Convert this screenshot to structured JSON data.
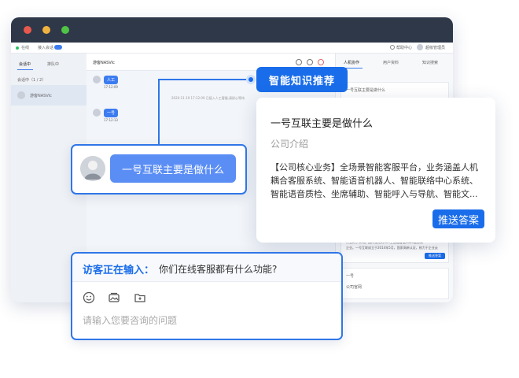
{
  "topbar": {
    "status_label": "在线",
    "access_label": "接入会话",
    "help_label": "帮助中心",
    "user_label": "超级管理员"
  },
  "left_panel": {
    "tabs": [
      "会话中",
      "排队中"
    ],
    "session_count": "会话中（1 / 2）",
    "session_item": "游客NASVlc"
  },
  "chat": {
    "visitor_name": "游客NASVlc",
    "msg1": "人工",
    "msg1_time": "17:12:09",
    "system_note": "2020-11-19 17:12:09 已接入人工客服,请耐心等待",
    "msg2": "一号",
    "msg2_time": "17:12:13"
  },
  "right_panel": {
    "tabs": [
      "人机协作",
      "用户资料",
      "知识搜索"
    ],
    "query_preview": "一号互联主要是做什么",
    "bg_text_1": "行业的子公司。国内领先的AI人工智能客服SaaS服务商",
    "bg_text_2": "企业。一号互联成立于2014年5月，国家高新认证，致力于企业云",
    "bg_btn": "推送答案",
    "bg_item_1": "一号",
    "bg_item_2": "公司官网"
  },
  "knowledge": {
    "tag": "智能知识推荐",
    "question": "一号互联主要是做什么",
    "category": "公司介绍",
    "answer_line1": "【公司核心业务】全场景智能客服平台，业务涵盖人机",
    "answer_line2": "耦合客服系统、智能语音机器人、智能联络中心系统、",
    "answer_line3": "智能语音质检、坐席辅助、智能呼入与导航、智能文...",
    "push_button": "推送答案"
  },
  "question_card": {
    "text": "一号互联主要是做什么"
  },
  "input_card": {
    "typing_label": "访客正在输入：",
    "typing_text": "你们在线客服都有什么功能?",
    "placeholder": "请输入您要咨询的问题"
  },
  "icons": [
    "emoji-icon",
    "image-icon",
    "folder-icon",
    "question-mark-icon",
    "record-icon",
    "close-circle-icon",
    "help-icon",
    "user-avatar-icon"
  ],
  "colors": {
    "accent": "#1a6dea",
    "bubble": "#5b8ef5",
    "titlebar": "#2f3848",
    "dot_red": "#e8584c",
    "dot_yellow": "#f1b33f",
    "dot_green": "#4fc447"
  }
}
